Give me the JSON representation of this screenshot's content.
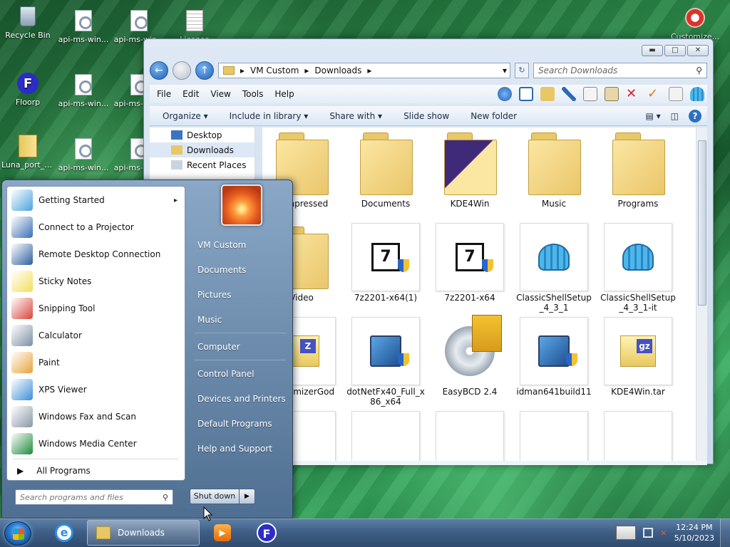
{
  "desktop": {
    "icons": [
      {
        "label": "Recycle Bin",
        "icon": "recycle-bin-icon"
      },
      {
        "label": "api-ms-win...",
        "icon": "dll-file-icon"
      },
      {
        "label": "api-ms-win...",
        "icon": "dll-file-icon"
      },
      {
        "label": "License",
        "icon": "text-document-icon"
      },
      {
        "label": "Customize...",
        "icon": "gear-icon"
      },
      {
        "label": "Floorp",
        "icon": "floorp-icon"
      },
      {
        "label": "api-ms-win...",
        "icon": "dll-file-icon"
      },
      {
        "label": "api-ms-win...",
        "icon": "dll-file-icon"
      },
      {
        "label": "Luna_port_t...",
        "icon": "zip-folder-icon"
      },
      {
        "label": "api-ms-win...",
        "icon": "dll-file-icon"
      },
      {
        "label": "api-ms-win...",
        "icon": "dll-file-icon"
      }
    ]
  },
  "explorer": {
    "address": {
      "segments": [
        "VM Custom",
        "Downloads"
      ]
    },
    "search": {
      "placeholder": "Search Downloads"
    },
    "menu": [
      "File",
      "Edit",
      "View",
      "Tools",
      "Help"
    ],
    "commands": [
      "Organize",
      "Include in library",
      "Share with",
      "Slide show",
      "New folder"
    ],
    "nav": [
      {
        "label": "Desktop",
        "icon": "desktop-icon"
      },
      {
        "label": "Downloads",
        "icon": "downloads-folder-icon",
        "selected": true
      },
      {
        "label": "Recent Places",
        "icon": "recent-places-icon"
      }
    ],
    "files": [
      {
        "name": "Compressed",
        "kind": "folder"
      },
      {
        "name": "Documents",
        "kind": "folder"
      },
      {
        "name": "KDE4Win",
        "kind": "folder-kde"
      },
      {
        "name": "Music",
        "kind": "folder"
      },
      {
        "name": "Programs",
        "kind": "folder"
      },
      {
        "name": "Video",
        "kind": "folder"
      },
      {
        "name": "7z2201-x64(1)",
        "kind": "7zip"
      },
      {
        "name": "7z2201-x64",
        "kind": "7zip"
      },
      {
        "name": "ClassicShellSetup_4_3_1",
        "kind": "shell"
      },
      {
        "name": "ClassicShellSetup_4_3_1-it",
        "kind": "shell"
      },
      {
        "name": "CustomizerGod",
        "kind": "zip"
      },
      {
        "name": "dotNetFx40_Full_x86_x64",
        "kind": "setup"
      },
      {
        "name": "EasyBCD 2.4",
        "kind": "easybcd"
      },
      {
        "name": "idman641build11",
        "kind": "setup"
      },
      {
        "name": "KDE4Win.tar",
        "kind": "gz"
      }
    ]
  },
  "startmenu": {
    "programs": [
      {
        "label": "Getting Started",
        "icon": "getting-started-icon",
        "color": "#4aa3df",
        "submenu": true
      },
      {
        "label": "Connect to a Projector",
        "icon": "projector-icon",
        "color": "#3a6fb5"
      },
      {
        "label": "Remote Desktop Connection",
        "icon": "remote-desktop-icon",
        "color": "#2d5f9e"
      },
      {
        "label": "Sticky Notes",
        "icon": "sticky-notes-icon",
        "color": "#f3df5a"
      },
      {
        "label": "Snipping Tool",
        "icon": "snipping-tool-icon",
        "color": "#d9433a"
      },
      {
        "label": "Calculator",
        "icon": "calculator-icon",
        "color": "#7d8ea3"
      },
      {
        "label": "Paint",
        "icon": "paint-icon",
        "color": "#e7a23c"
      },
      {
        "label": "XPS Viewer",
        "icon": "xps-viewer-icon",
        "color": "#3b8fd6"
      },
      {
        "label": "Windows Fax and Scan",
        "icon": "fax-scan-icon",
        "color": "#8a97a6"
      },
      {
        "label": "Windows Media Center",
        "icon": "media-center-icon",
        "color": "#1f8a3c"
      }
    ],
    "all_programs": "All Programs",
    "search_placeholder": "Search programs and files",
    "right_links": [
      "VM Custom",
      "Documents",
      "Pictures",
      "Music",
      "Computer",
      "Control Panel",
      "Devices and Printers",
      "Default Programs",
      "Help and Support"
    ],
    "shutdown": "Shut down"
  },
  "taskbar": {
    "active_window": "Downloads",
    "clock_time": "12:24 PM",
    "clock_date": "5/10/2023"
  }
}
